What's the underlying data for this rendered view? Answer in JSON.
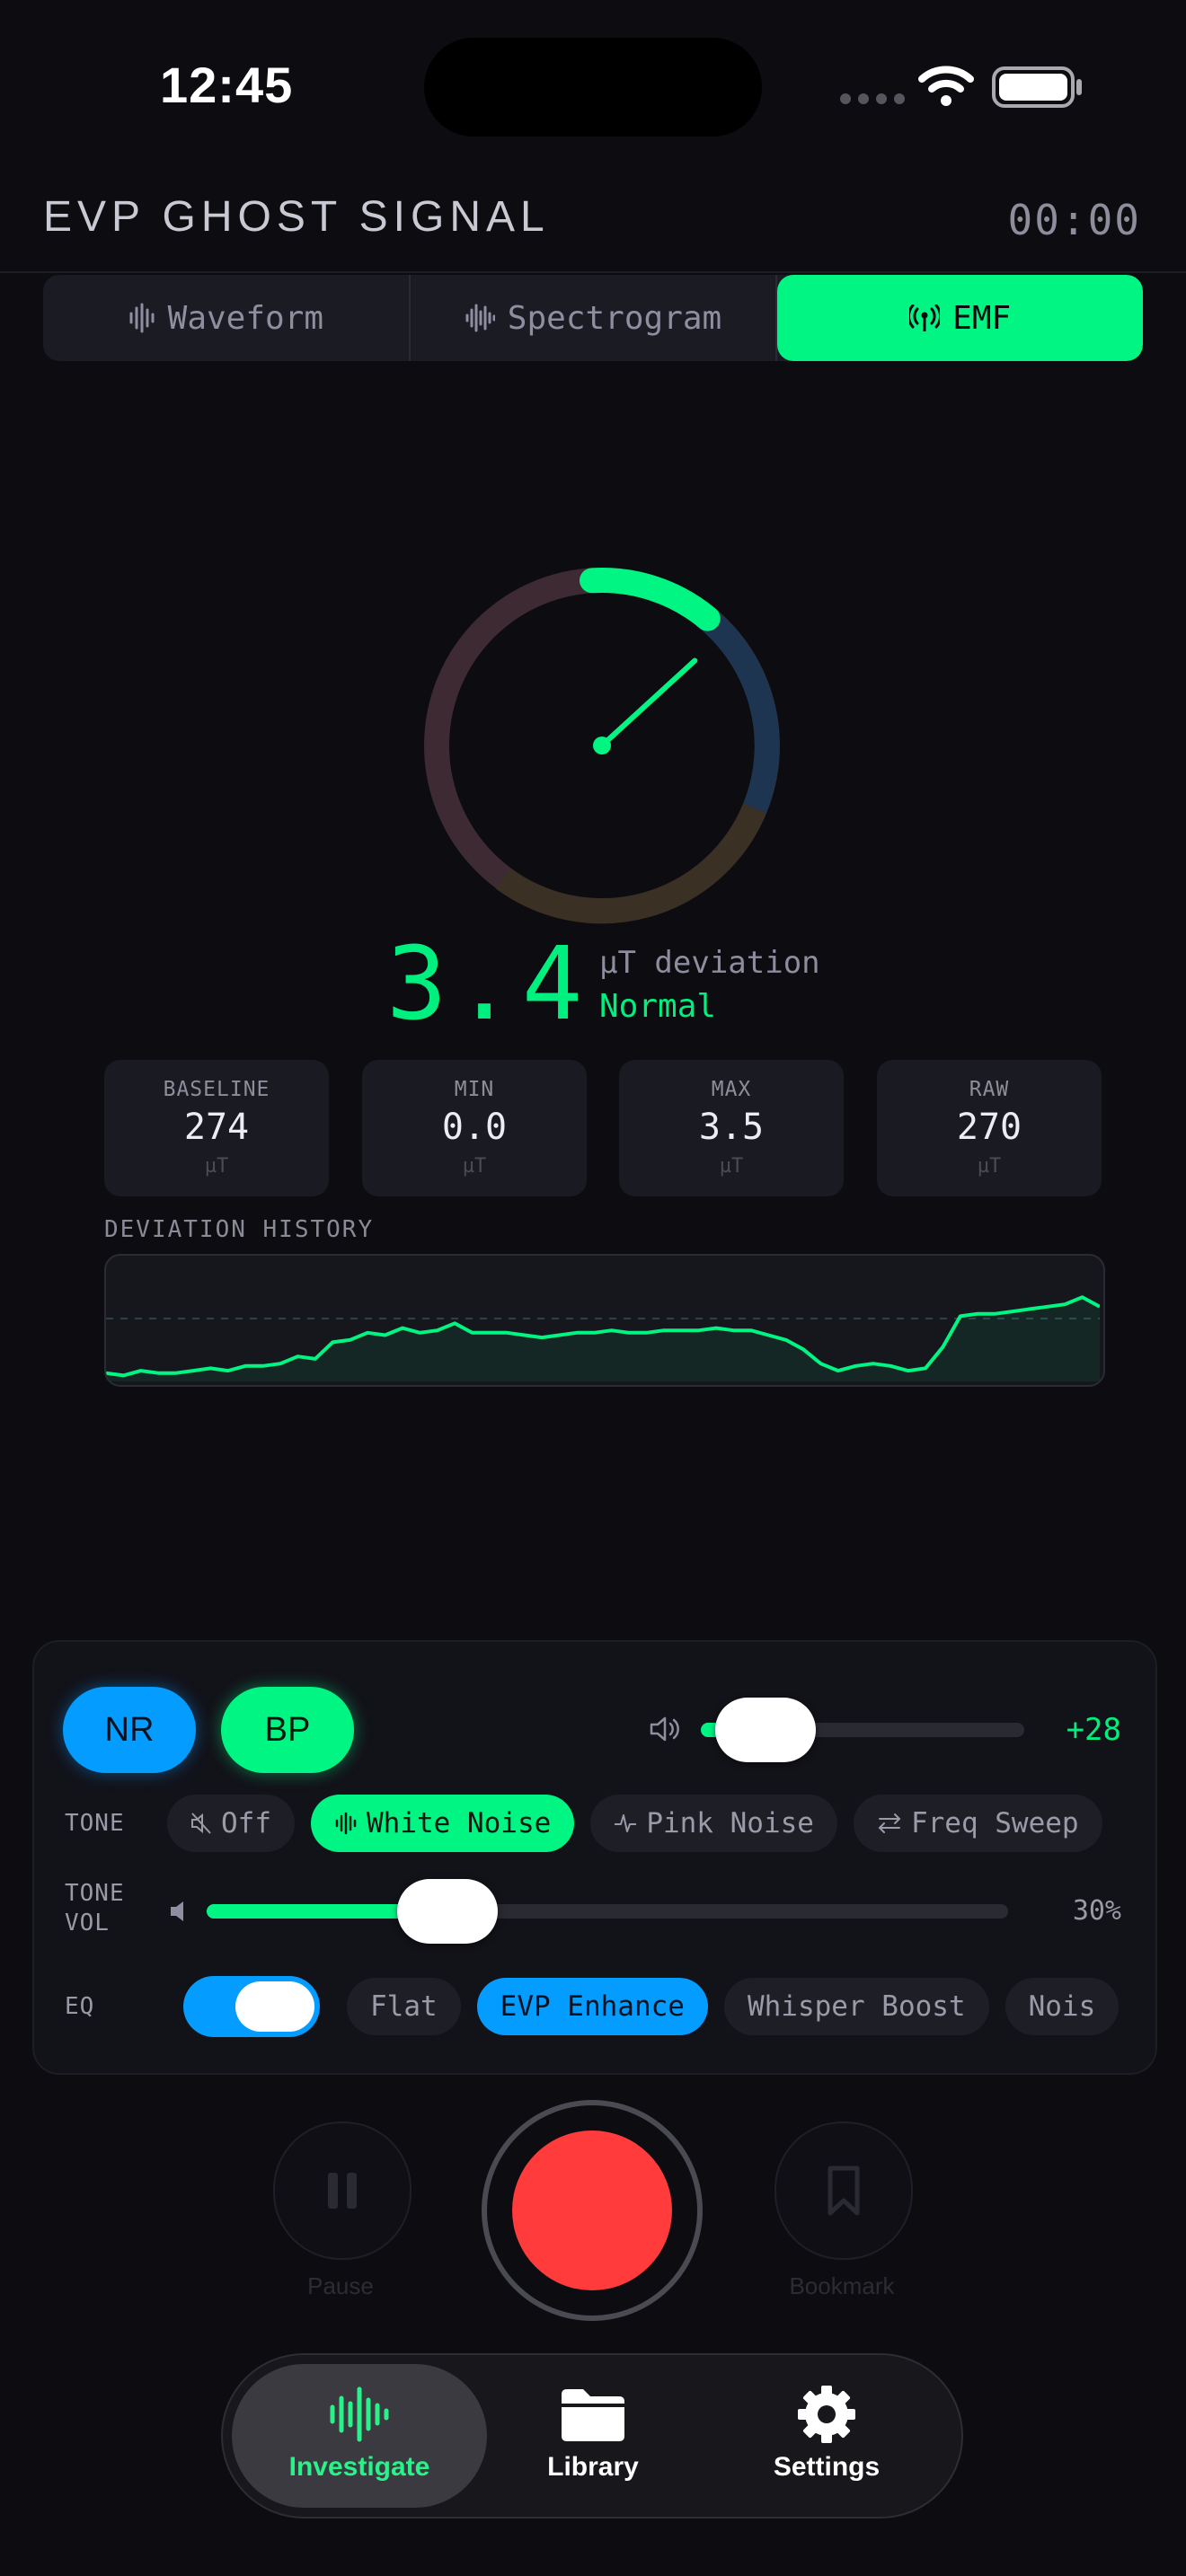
{
  "status": {
    "time": "12:45"
  },
  "header": {
    "title": "EVP GHOST SIGNAL",
    "timer": "00:00"
  },
  "tabs": [
    {
      "label": "Waveform",
      "icon": "waveform-icon"
    },
    {
      "label": "Spectrogram",
      "icon": "spectrogram-icon"
    },
    {
      "label": "EMF",
      "icon": "antenna-icon",
      "active": true
    }
  ],
  "reading": {
    "value": "3.4",
    "unit": "µT deviation",
    "status": "Normal",
    "gauge_level": 0.12
  },
  "stats": [
    {
      "label": "BASELINE",
      "value": "274",
      "unit": "µT"
    },
    {
      "label": "MIN",
      "value": "0.0",
      "unit": "µT"
    },
    {
      "label": "MAX",
      "value": "3.5",
      "unit": "µT"
    },
    {
      "label": "RAW",
      "value": "270",
      "unit": "µT"
    }
  ],
  "history": {
    "label": "DEVIATION HISTORY",
    "values": [
      0.2,
      0.1,
      0.3,
      0.2,
      0.2,
      0.3,
      0.4,
      0.3,
      0.5,
      0.5,
      0.6,
      0.9,
      0.8,
      1.5,
      1.6,
      1.9,
      1.8,
      2.1,
      1.9,
      2.0,
      2.3,
      1.9,
      1.9,
      1.9,
      1.8,
      1.7,
      1.8,
      1.9,
      1.9,
      2.0,
      1.9,
      1.9,
      2.0,
      2.0,
      2.0,
      2.1,
      2.0,
      2.0,
      1.8,
      1.6,
      1.2,
      0.6,
      0.3,
      0.5,
      0.6,
      0.5,
      0.3,
      0.4,
      1.3,
      2.6,
      2.7,
      2.7,
      2.8,
      2.9,
      3.0,
      3.1,
      3.4,
      3.0
    ]
  },
  "controls": {
    "nr_label": "NR",
    "bp_label": "BP",
    "gain_value": "+28",
    "gain_level": 0.2,
    "tone": {
      "label": "TONE",
      "options": [
        {
          "label": "Off",
          "icon": "mute-icon"
        },
        {
          "label": "White Noise",
          "icon": "noise-icon",
          "selected": true
        },
        {
          "label": "Pink Noise",
          "icon": "pulse-icon"
        },
        {
          "label": "Freq Sweep",
          "icon": "sweep-icon"
        }
      ]
    },
    "tone_vol": {
      "label_line1": "TONE",
      "label_line2": "VOL",
      "value": "30%",
      "level": 0.3
    },
    "eq": {
      "label": "EQ",
      "enabled": true,
      "options": [
        {
          "label": "Flat"
        },
        {
          "label": "EVP Enhance",
          "selected": true
        },
        {
          "label": "Whisper Boost"
        },
        {
          "label": "Nois"
        }
      ]
    }
  },
  "transport": {
    "pause_label": "Pause",
    "bookmark_label": "Bookmark"
  },
  "nav": [
    {
      "label": "Investigate",
      "icon": "waveform-icon",
      "active": true
    },
    {
      "label": "Library",
      "icon": "folder-icon"
    },
    {
      "label": "Settings",
      "icon": "gear-icon"
    }
  ],
  "colors": {
    "accent_green": "#00f583",
    "accent_blue": "#049cff",
    "record_red": "#ff3b3b",
    "background": "#0c0c11"
  }
}
